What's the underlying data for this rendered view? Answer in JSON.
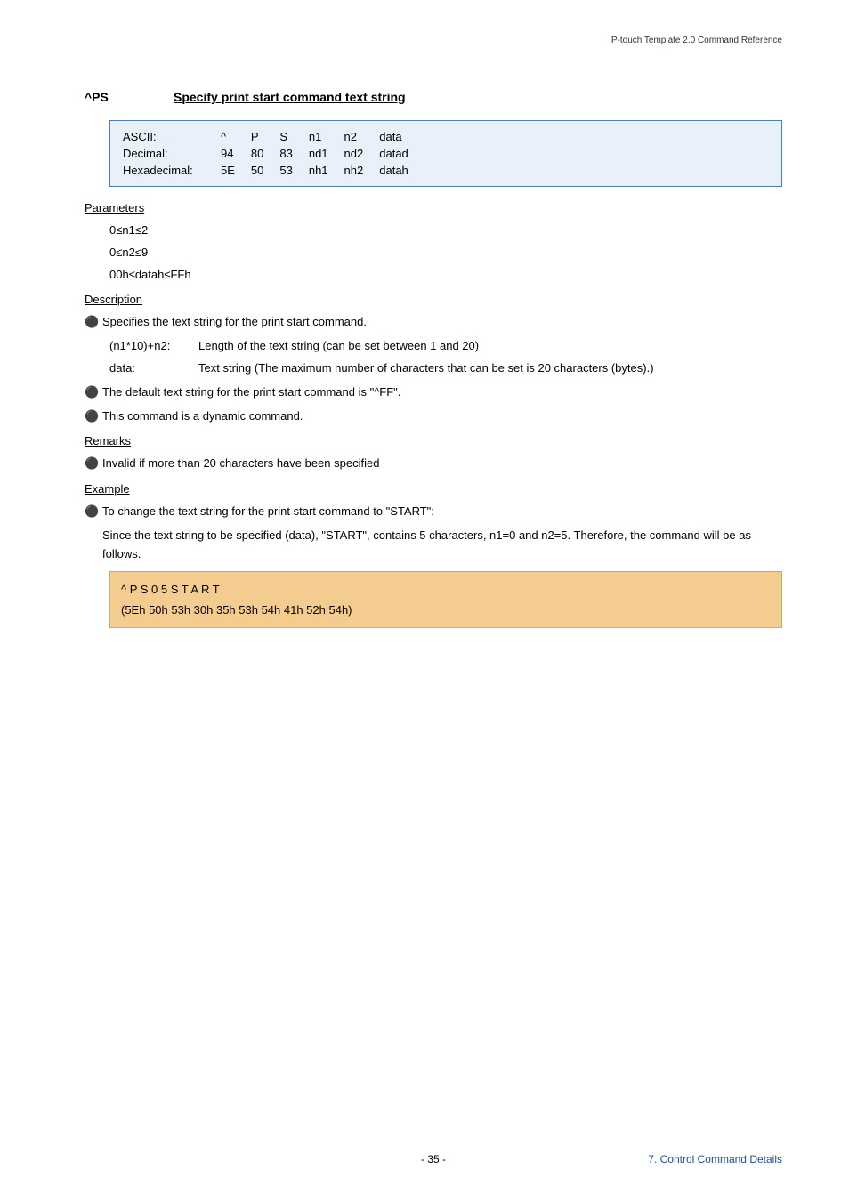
{
  "header": {
    "doc_title": "P-touch Template 2.0 Command Reference"
  },
  "title": {
    "cmd": "^PS",
    "desc": "Specify print start command text string"
  },
  "code_table": {
    "rows": [
      {
        "label": "ASCII:",
        "c": [
          "^",
          "P",
          "S",
          "n1",
          "n2",
          "data"
        ]
      },
      {
        "label": "Decimal:",
        "c": [
          "94",
          "80",
          "83",
          "nd1",
          "nd2",
          "datad"
        ]
      },
      {
        "label": "Hexadecimal:",
        "c": [
          "5E",
          "50",
          "53",
          "nh1",
          "nh2",
          "datah"
        ]
      }
    ]
  },
  "parameters": {
    "heading": "Parameters",
    "lines": [
      "0≤n1≤2",
      "0≤n2≤9",
      "00h≤datah≤FFh"
    ]
  },
  "description": {
    "heading": "Description",
    "bullets": [
      {
        "text": "Specifies the text string for the print start command.",
        "defs": [
          {
            "k": "(n1*10)+n2:",
            "v": "Length of the text string (can be set between 1 and 20)"
          },
          {
            "k": "data:",
            "v": "Text string (The maximum number of characters that can be set is 20 characters (bytes).)"
          }
        ]
      },
      {
        "text": "The default text string for the print start command is \"^FF\"."
      },
      {
        "text": "This command is a dynamic command."
      }
    ]
  },
  "remarks": {
    "heading": "Remarks",
    "bullets": [
      {
        "text": "Invalid if more than 20 characters have been specified"
      }
    ]
  },
  "example": {
    "heading": "Example",
    "bullet": "To change the text string for the print start command to \"START\":",
    "para": "Since the text string to be specified (data), \"START\", contains 5 characters, n1=0 and n2=5. Therefore, the command will be as follows.",
    "code_line1": "^ P S 0 5 S T A R T",
    "code_line2": "(5Eh 50h 53h 30h 35h 53h 54h 41h 52h 54h)"
  },
  "footer": {
    "page": "- 35 -",
    "section": "7. Control Command Details"
  }
}
